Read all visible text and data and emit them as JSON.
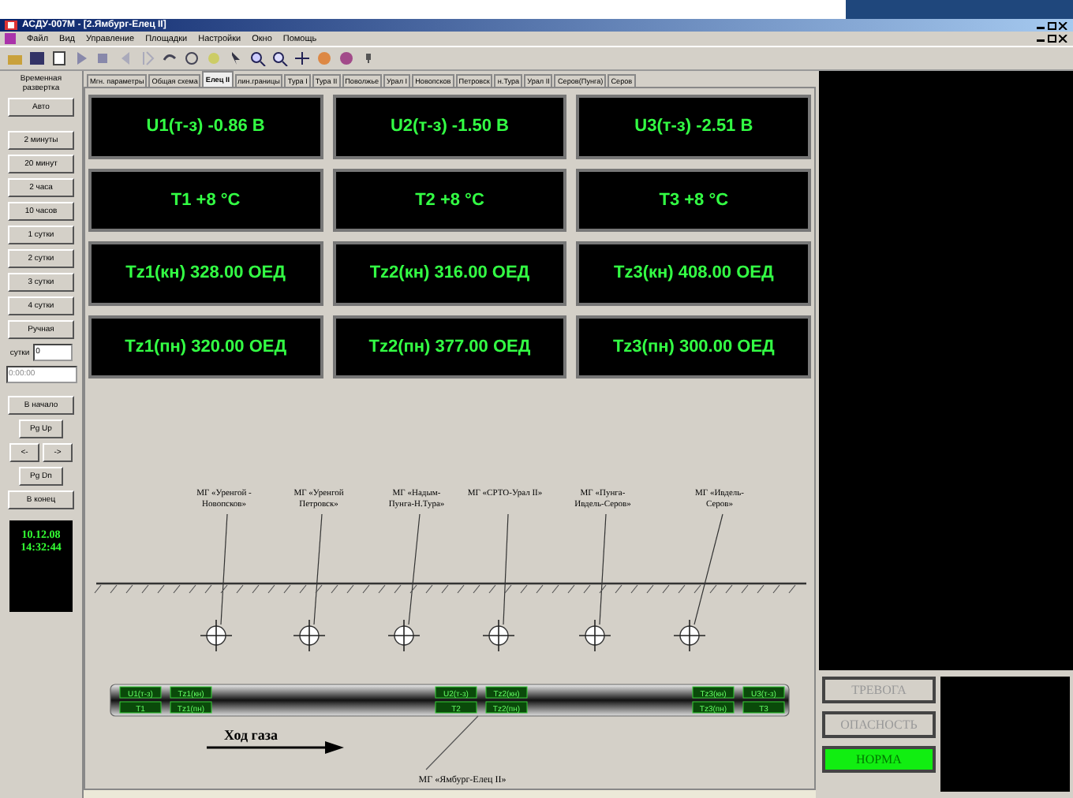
{
  "window": {
    "title": "АСДУ-007М - [2.Ямбург-Елец II]"
  },
  "menu": [
    "Файл",
    "Вид",
    "Управление",
    "Площадки",
    "Настройки",
    "Окно",
    "Помощь"
  ],
  "sidebar": {
    "title": "Временная развертка",
    "buttons": [
      "Авто",
      "2 минуты",
      "20 минут",
      "2 часа",
      "10 часов",
      "1 сутки",
      "2 сутки",
      "3 сутки",
      "4 сутки",
      "Ручная"
    ],
    "days_label": "сутки",
    "days_value": "0",
    "time_value": "0:00:00",
    "nav": [
      {
        "label": "В начало",
        "kind": "button"
      },
      {
        "label": "Pg Up",
        "kind": "small"
      },
      {
        "label": "<-",
        "kind": "pair"
      },
      {
        "label": "->",
        "kind": "pair"
      },
      {
        "label": "Pg Dn",
        "kind": "small"
      },
      {
        "label": "В конец",
        "kind": "button"
      }
    ],
    "clock": {
      "date": "10.12.08",
      "time": "14:32:44"
    }
  },
  "tabs": [
    {
      "label": "Мгн. параметры",
      "selected": false
    },
    {
      "label": "Общая схема",
      "selected": false
    },
    {
      "label": "Елец II",
      "selected": true
    },
    {
      "label": "лин.границы",
      "selected": false
    },
    {
      "label": "Тура I",
      "selected": false
    },
    {
      "label": "Тура II",
      "selected": false
    },
    {
      "label": "Поволжье",
      "selected": false
    },
    {
      "label": "Урал I",
      "selected": false
    },
    {
      "label": "Новопсков",
      "selected": false
    },
    {
      "label": "Петровск",
      "selected": false
    },
    {
      "label": "н.Тура",
      "selected": false
    },
    {
      "label": "Урал II",
      "selected": false
    },
    {
      "label": "Серов(Пунга)",
      "selected": false
    },
    {
      "label": "Серов",
      "selected": false
    }
  ],
  "readings": [
    "U1(т-з) -0.86 В",
    "U2(т-з) -1.50 В",
    "U3(т-з) -2.51 В",
    "T1 +8 °C",
    "T2 +8 °C",
    "T3 +8 °C",
    "Tz1(кн) 328.00 ОЕД",
    "Tz2(кн) 316.00 ОЕД",
    "Tz3(кн) 408.00 ОЕД",
    "Tz1(пн) 320.00 ОЕД",
    "Tz2(пн) 377.00 ОЕД",
    "Tz3(пн) 300.00 ОЕД"
  ],
  "stations": [
    [
      "МГ «Уренгой -",
      "Новопсков»"
    ],
    [
      "МГ «Уренгой",
      "Петровск»"
    ],
    [
      "МГ «Надым-",
      "Пунга-Н.Тура»"
    ],
    [
      "МГ «СРТО-Урал II»"
    ],
    [
      "МГ «Пунга-",
      "Ивдель-Серов»"
    ],
    [
      "МГ «Ивдель-",
      "Серов»"
    ]
  ],
  "pipe_tags": [
    {
      "top": [
        "U1(т-з)",
        "Tz1(кн)"
      ],
      "bottom": [
        "T1",
        "Tz1(пн)"
      ]
    },
    {
      "top": [
        "U2(т-з)",
        "Tz2(кн)"
      ],
      "bottom": [
        "T2",
        "Tz2(пн)"
      ]
    },
    {
      "top": [
        "Tz3(кн)",
        "U3(т-з)"
      ],
      "bottom": [
        "Tz3(пн)",
        "T3"
      ]
    }
  ],
  "flow_label": "Ход газа",
  "pipeline_label": "МГ «Ямбург-Елец II»",
  "alarms": [
    {
      "label": "ТРЕВОГА",
      "selected": false
    },
    {
      "label": "ОПАСНОСТЬ",
      "selected": false
    },
    {
      "label": "НОРМА",
      "selected": true
    }
  ]
}
